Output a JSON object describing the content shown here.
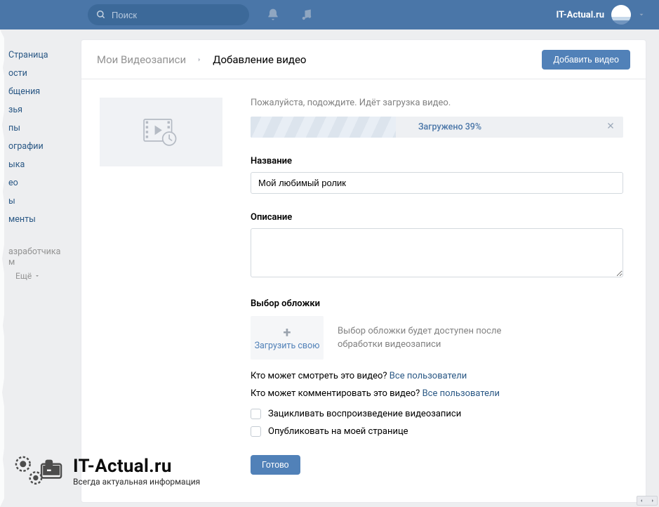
{
  "topbar": {
    "search_placeholder": "Поиск",
    "username": "IT-Actual.ru"
  },
  "nav": {
    "items": [
      "Страница",
      "ости",
      "бщения",
      "зья",
      "пы",
      "ографии",
      "ыка",
      "ео",
      "ы",
      "менты"
    ],
    "dev": "азработчикам",
    "more": "Ещё"
  },
  "breadcrumb": {
    "a": "Мои Видеозаписи",
    "b": "Добавление видео"
  },
  "header_button": "Добавить видео",
  "form": {
    "upload_wait": "Пожалуйста, подождите. Идёт загрузка видео.",
    "progress_text": "Загружено 39%",
    "progress_pct": 39,
    "title_label": "Название",
    "title_value": "Мой любимый ролик",
    "desc_label": "Описание",
    "desc_value": "",
    "cover_label": "Выбор обложки",
    "cover_upload": "Загрузить свою",
    "cover_hint": "Выбор обложки будет доступен после обработки видеозаписи",
    "priv_watch_q": "Кто может смотреть это видео?",
    "priv_comment_q": "Кто может комментировать это видео?",
    "priv_all": "Все пользователи",
    "loop_label": "Зацикливать воспроизведение видеозаписи",
    "publish_label": "Опубликовать на моей странице",
    "done": "Готово"
  },
  "watermark": {
    "line1": "IT-Actual.ru",
    "line2": "Всегда актуальная информация"
  }
}
